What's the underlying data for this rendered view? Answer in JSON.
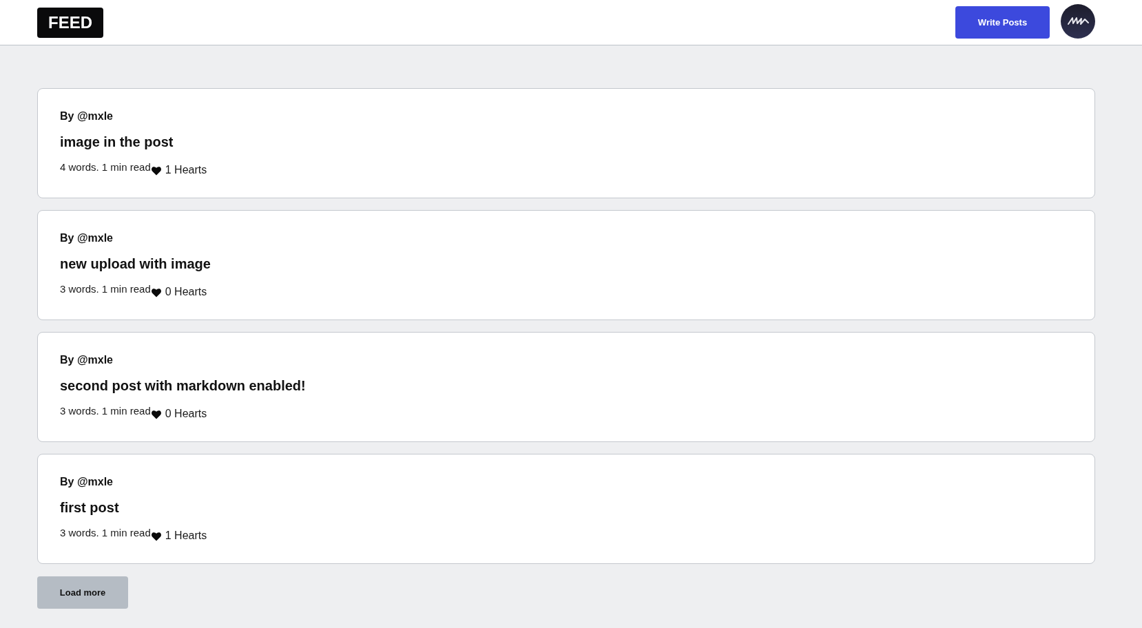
{
  "header": {
    "logo": "FEED",
    "write_button": "Write Posts"
  },
  "posts": [
    {
      "author": "By @mxle",
      "title": "image in the post",
      "meta": "4 words. 1 min read",
      "hearts": "1 Hearts"
    },
    {
      "author": "By @mxle",
      "title": "new upload with image",
      "meta": "3 words. 1 min read",
      "hearts": "0 Hearts"
    },
    {
      "author": "By @mxle",
      "title": "second post with markdown enabled!",
      "meta": "3 words. 1 min read",
      "hearts": "0 Hearts"
    },
    {
      "author": "By @mxle",
      "title": "first post",
      "meta": "3 words. 1 min read",
      "hearts": "1 Hearts"
    }
  ],
  "load_more": "Load more"
}
